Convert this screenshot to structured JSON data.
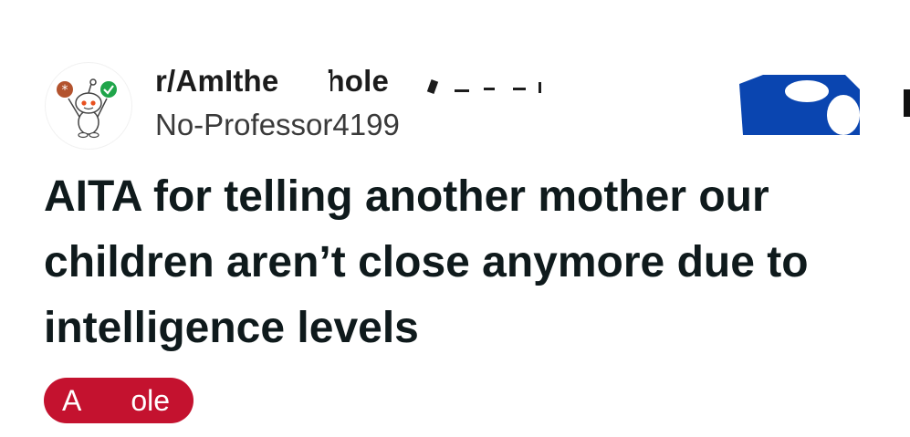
{
  "post": {
    "subreddit": "r/AmIthe",
    "subreddit_suffix": "hole",
    "username": "No-Professor4199",
    "title": "AITA for telling another mother our children aren’t close anymore due to intelligence levels",
    "flair": "A",
    "flair_suffix": "ole"
  },
  "icons": {
    "avatar": "reddit-snoo-avatar-icon",
    "more": "more-options-icon"
  },
  "colors": {
    "flair": "#c4122f",
    "join_button": "#0a45b0",
    "title": "#0f1a1c"
  }
}
